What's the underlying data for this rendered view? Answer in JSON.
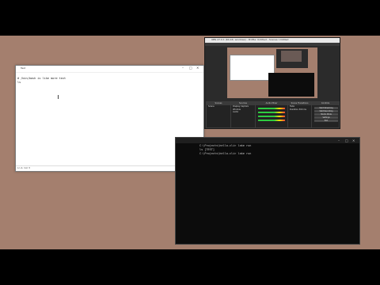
{
  "notepad": {
    "title": "Test",
    "lines": [
      "# /bin/bash is like more text",
      "ls"
    ],
    "status": "Ln 2, Col 3",
    "controls": [
      "–",
      "□",
      "✕"
    ]
  },
  "obs": {
    "title": "OBS 27.0.1 (64-bit, windows) - Profile: Untitled - Scenes: Untitled",
    "docks": {
      "scenes": {
        "header": "Scenes",
        "items": [
          "Scene"
        ]
      },
      "sources": {
        "header": "Sources",
        "items": [
          "Display Capture",
          "Window",
          "Audio"
        ]
      },
      "mixer": {
        "header": "Audio Mixer"
      },
      "transitions": {
        "header": "Scene Transitions",
        "items": [
          "Fade",
          "Duration 300 ms"
        ]
      },
      "controls": {
        "header": "Controls",
        "buttons": [
          "Start Streaming",
          "Start Recording",
          "Studio Mode",
          "Settings",
          "Exit"
        ]
      }
    }
  },
  "terminal": {
    "lines": [
      "C:\\Projects\\hello-cli> lake run",
      "ls [TEST]",
      "C:\\Projects\\hello-cli> lake run"
    ],
    "controls": [
      "–",
      "□",
      "✕"
    ]
  }
}
